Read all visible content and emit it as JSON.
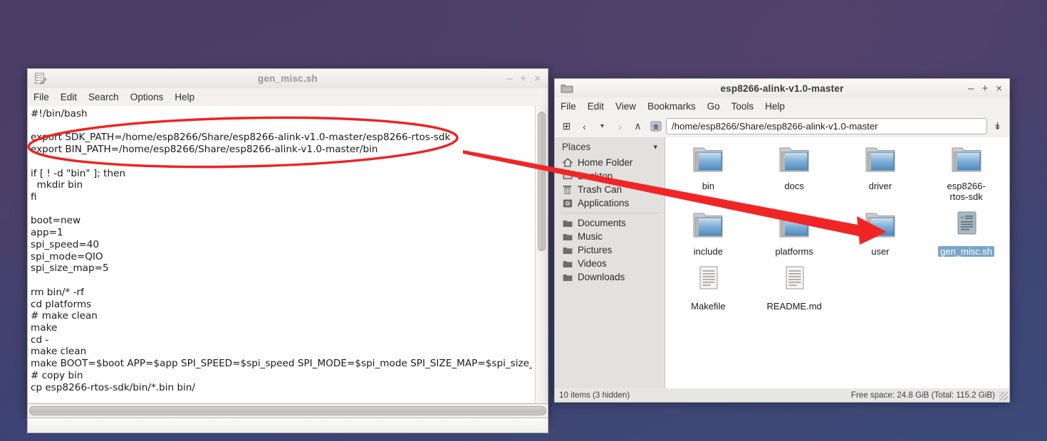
{
  "desktop": {
    "bg_top": "#4a3e66",
    "bg_bottom": "#3b4b7a"
  },
  "annotation": {
    "color": "#ee2222",
    "ellipse_label": "export-lines-ellipse",
    "arrow_label": "pointer-arrow"
  },
  "editor": {
    "title": "gen_misc.sh",
    "icon": "text-editor-icon",
    "window_buttons": {
      "minimize": "–",
      "maximize": "+",
      "close": "×"
    },
    "menu": [
      "File",
      "Edit",
      "Search",
      "Options",
      "Help"
    ],
    "content": "#!/bin/bash\n\nexport SDK_PATH=/home/esp8266/Share/esp8266-alink-v1.0-master/esp8266-rtos-sdk\nexport BIN_PATH=/home/esp8266/Share/esp8266-alink-v1.0-master/bin\n\nif [ ! -d \"bin\" ]; then\n  mkdir bin\nfi\n\nboot=new\napp=1\nspi_speed=40\nspi_mode=QIO\nspi_size_map=5\n\nrm bin/* -rf\ncd platforms\n# make clean\nmake\ncd -\nmake clean\nmake BOOT=$boot APP=$app SPI_SPEED=$spi_speed SPI_MODE=$spi_mode SPI_SIZE_MAP=$spi_size_map\n# copy bin\ncp esp8266-rtos-sdk/bin/*.bin bin/"
  },
  "filemanager": {
    "title": "esp8266-alink-v1.0-master",
    "icon": "folder-icon",
    "window_buttons": {
      "minimize": "–",
      "maximize": "+",
      "close": "×"
    },
    "menu": [
      "File",
      "Edit",
      "View",
      "Bookmarks",
      "Go",
      "Tools",
      "Help"
    ],
    "toolbar": {
      "new_tab": "⊞",
      "back": "‹",
      "history": "▾",
      "forward": "›",
      "up": "∧",
      "home": "⌂",
      "path": "/home/esp8266/Share/esp8266-alink-v1.0-master",
      "path_dropdown": "↡"
    },
    "places": {
      "header": "Places",
      "collapse": "▾",
      "group1": [
        {
          "label": "Home Folder",
          "icon": "home-icon"
        },
        {
          "label": "Desktop",
          "icon": "desktop-icon"
        },
        {
          "label": "Trash Can",
          "icon": "trash-icon"
        },
        {
          "label": "Applications",
          "icon": "applications-icon"
        }
      ],
      "group2": [
        {
          "label": "Documents",
          "icon": "folder-icon"
        },
        {
          "label": "Music",
          "icon": "folder-icon"
        },
        {
          "label": "Pictures",
          "icon": "folder-icon"
        },
        {
          "label": "Videos",
          "icon": "folder-icon"
        },
        {
          "label": "Downloads",
          "icon": "folder-icon"
        }
      ]
    },
    "files": [
      {
        "name": "bin",
        "type": "folder",
        "selected": false
      },
      {
        "name": "docs",
        "type": "folder",
        "selected": false
      },
      {
        "name": "driver",
        "type": "folder",
        "selected": false
      },
      {
        "name": "esp8266-rtos-sdk",
        "type": "folder",
        "selected": false
      },
      {
        "name": "include",
        "type": "folder",
        "selected": false
      },
      {
        "name": "platforms",
        "type": "folder",
        "selected": false
      },
      {
        "name": "user",
        "type": "folder",
        "selected": false
      },
      {
        "name": "gen_misc.sh",
        "type": "script",
        "selected": true
      },
      {
        "name": "Makefile",
        "type": "document",
        "selected": false
      },
      {
        "name": "README.md",
        "type": "document",
        "selected": false
      }
    ],
    "status": {
      "items": "10 items (3 hidden)",
      "free_space": "Free space: 24.8 GiB (Total: 115.2 GiB)"
    }
  }
}
